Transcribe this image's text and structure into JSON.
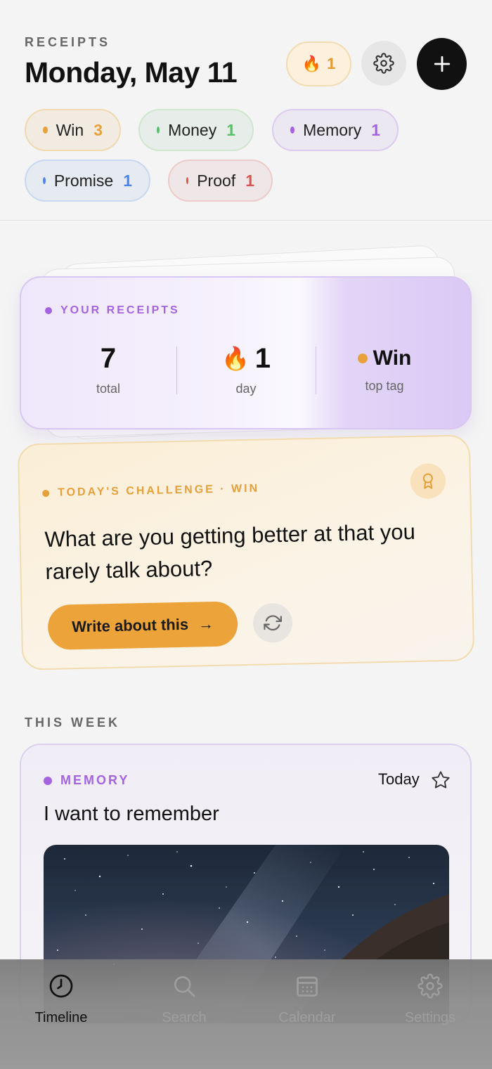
{
  "header": {
    "eyebrow": "RECEIPTS",
    "title": "Monday, May 11",
    "streak_emoji": "🔥",
    "streak_count": "1"
  },
  "tags": [
    {
      "label": "Win",
      "count": "3",
      "color": "#e9a13b",
      "bg": "#f1ebe1",
      "border": "#f0d9b0"
    },
    {
      "label": "Money",
      "count": "1",
      "color": "#5cbf6a",
      "bg": "#e7ede8",
      "border": "#cfe6cf"
    },
    {
      "label": "Memory",
      "count": "1",
      "color": "#a464e0",
      "bg": "#ece8f2",
      "border": "#dccbef"
    },
    {
      "label": "Promise",
      "count": "1",
      "color": "#4b86e8",
      "bg": "#e6eaf1",
      "border": "#c9d8f1"
    },
    {
      "label": "Proof",
      "count": "1",
      "color": "#e05252",
      "bg": "#efe7e7",
      "border": "#efcaca"
    }
  ],
  "stats": {
    "label": "YOUR RECEIPTS",
    "total_value": "7",
    "total_label": "total",
    "day_emoji": "🔥",
    "day_value": "1",
    "day_label": "day",
    "top_tag_value": "Win",
    "top_tag_label": "top tag",
    "top_tag_color": "#e9a13b"
  },
  "challenge": {
    "label": "TODAY'S CHALLENGE · WIN",
    "question": "What are you getting better at that you rarely talk about?",
    "button_label": "Write about this",
    "button_arrow": "→"
  },
  "this_week": {
    "title": "THIS WEEK",
    "entries": [
      {
        "tag": "MEMORY",
        "date": "Today",
        "title": "I want to remember"
      }
    ]
  },
  "tabbar": {
    "tabs": [
      {
        "label": "Timeline",
        "icon": "clock-icon",
        "active": true
      },
      {
        "label": "Search",
        "icon": "search-icon",
        "active": false
      },
      {
        "label": "Calendar",
        "icon": "calendar-icon",
        "active": false
      },
      {
        "label": "Settings",
        "icon": "gear-icon",
        "active": false
      }
    ]
  }
}
